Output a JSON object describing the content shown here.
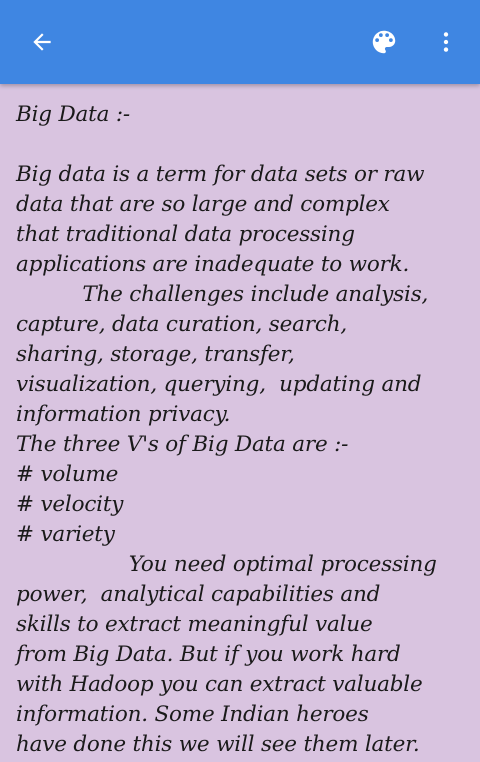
{
  "appbar": {
    "color": "#3f86e2",
    "back_icon": "arrow-back-icon",
    "palette_icon": "palette-icon",
    "more_icon": "more-vert-icon"
  },
  "note": {
    "background": "#d9c4e0",
    "title": "Big Data :-",
    "lines": [
      "Big data is a term for data sets or raw",
      "data that are so large and complex",
      "that traditional data processing",
      "applications are inadequate to work.",
      "          The challenges include analysis,",
      "capture, data curation, search,",
      "sharing, storage, transfer,",
      "visualization, querying,  updating and",
      "information privacy.",
      "The three V's of Big Data are :-",
      "# volume",
      "# velocity",
      "# variety",
      "                 You need optimal processing",
      "power,  analytical capabilities and",
      "skills to extract meaningful value",
      "from Big Data. But if you work hard",
      "with Hadoop you can extract valuable",
      "information. Some Indian heroes",
      "have done this we will see them later."
    ]
  }
}
